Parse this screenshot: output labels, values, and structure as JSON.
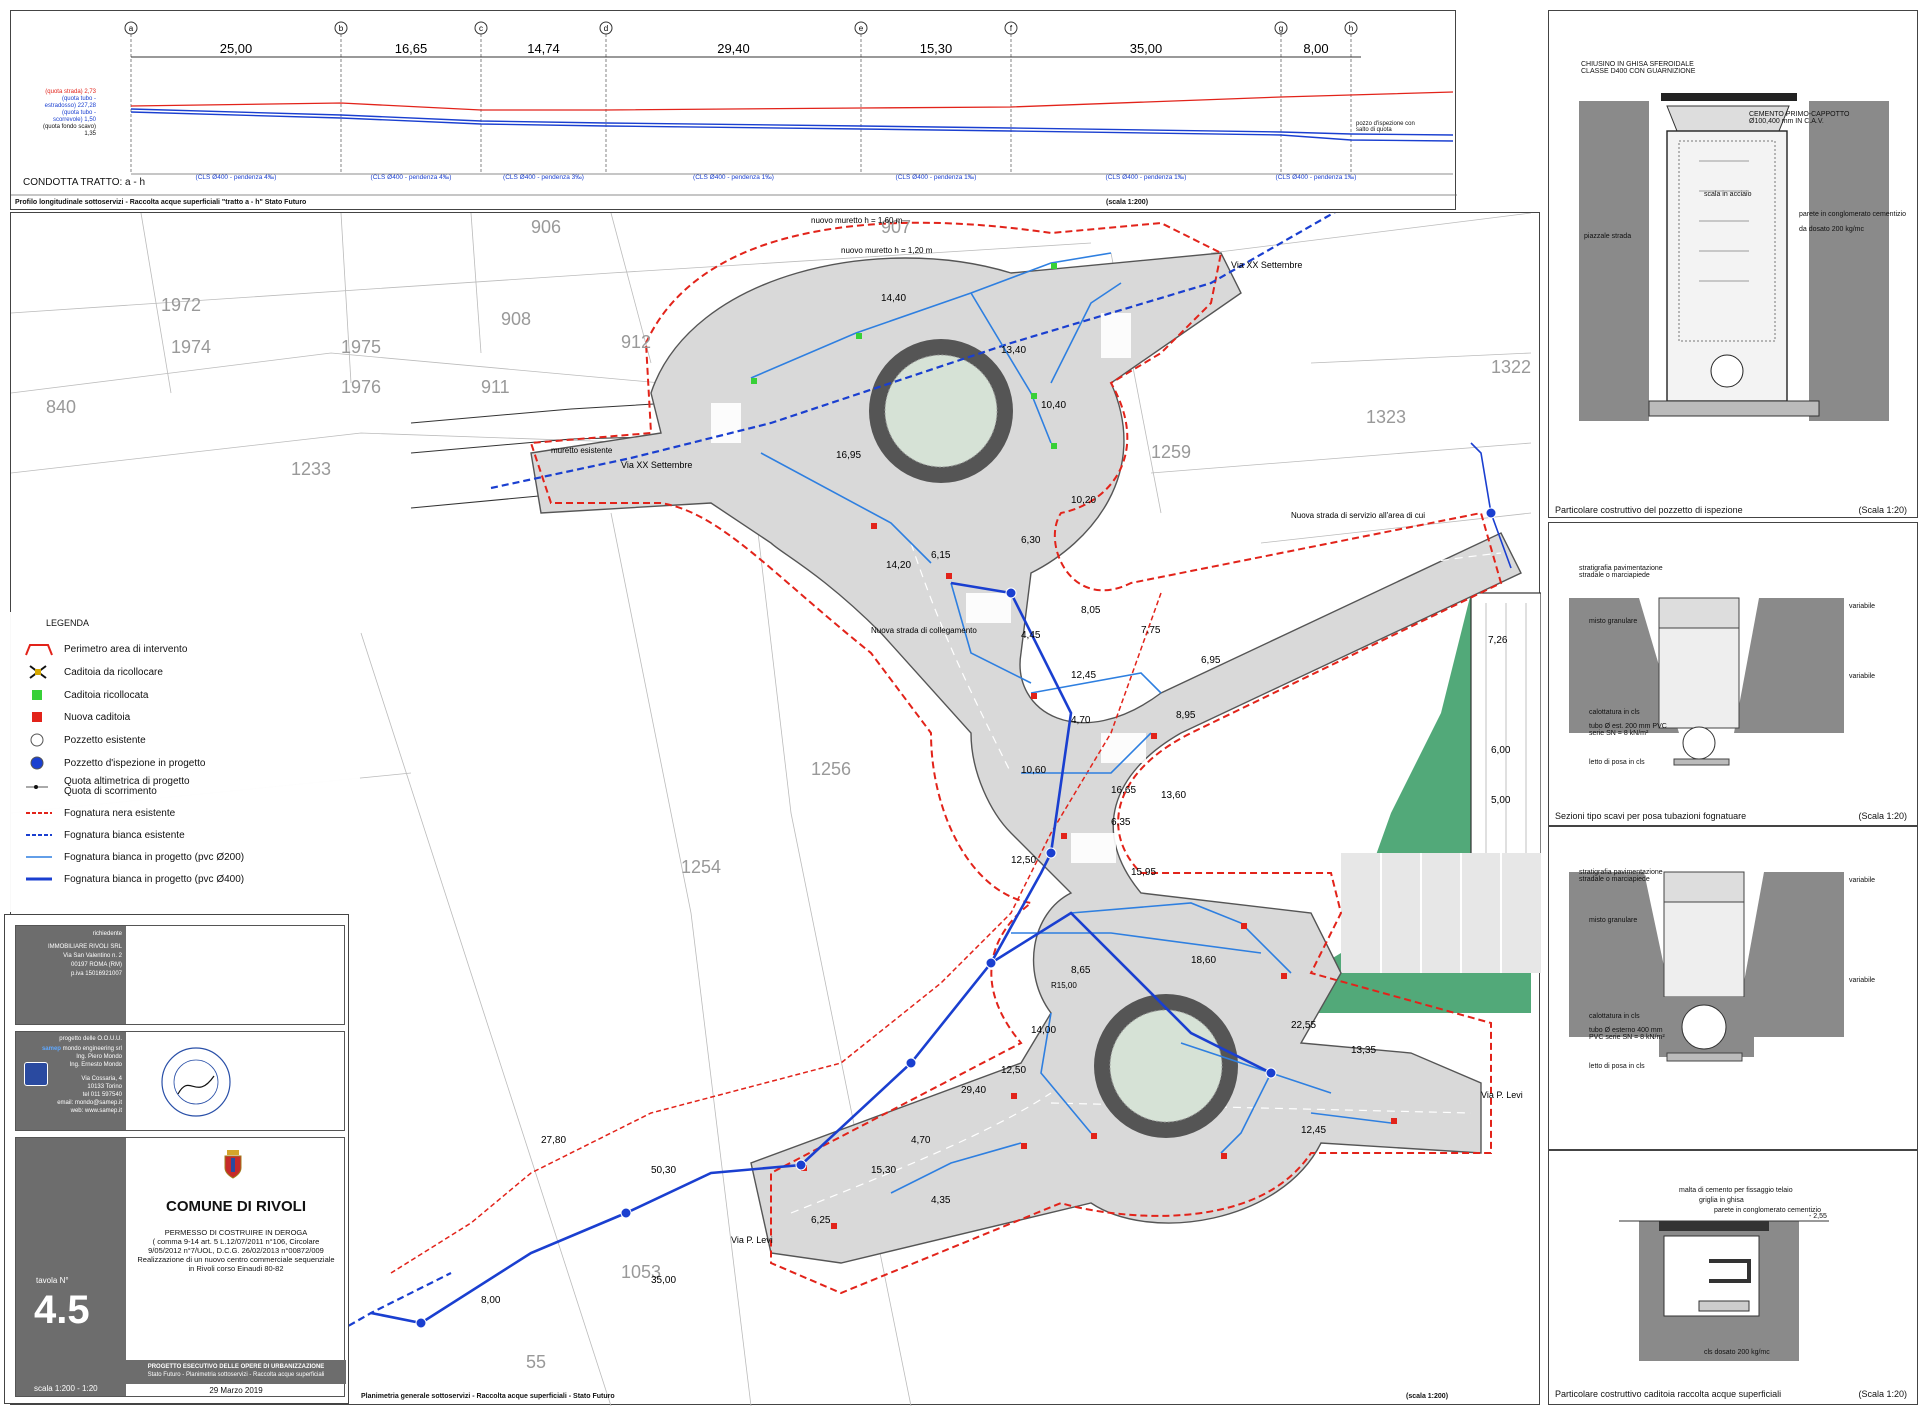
{
  "profile": {
    "markers": [
      "a",
      "b",
      "c",
      "d",
      "e",
      "f",
      "g",
      "h"
    ],
    "distances": [
      "25,00",
      "16,65",
      "14,74",
      "29,40",
      "15,30",
      "35,00",
      "8,00"
    ],
    "quota_labels": [
      "(quota strada) 2,73",
      "(quota tubo - estradosso) 227,28",
      "(quota tubo - scorrevole) 1,50",
      "(quota fondo scavo) 1,35"
    ],
    "conduit_label": "CONDOTTA TRATTO: a - h",
    "segment_notes": [
      "(CLS Ø400 - pendenza 4‰)",
      "(CLS Ø400 - pendenza 4‰)",
      "(CLS Ø400 - pendenza 3‰)",
      "(CLS Ø400 - pendenza 1‰)",
      "(CLS Ø400 - pendenza 1‰)",
      "(CLS Ø400 - pendenza 1‰)",
      "(CLS Ø400 - pendenza 1‰)"
    ],
    "inspection_note": "pozzo d'ispezione con salto di quota",
    "caption": "Profilo longitudinale sottoservizi - Raccolta acque superficiali \"tratto a - h\" Stato Futuro",
    "scale": "(scala 1:200)"
  },
  "plan": {
    "caption": "Planimetria generale sottoservizi - Raccolta acque superficiali - Stato Futuro",
    "scale": "(scala 1:200)",
    "parcels": [
      "906",
      "907",
      "1972",
      "908",
      "1974",
      "1975",
      "912",
      "1976",
      "911",
      "840",
      "1233",
      "1322",
      "1323",
      "1259",
      "1256",
      "1254",
      "1053",
      "55"
    ],
    "street_labels": [
      "Via XX Settembre",
      "Via XX Settembre",
      "Via P. Levi",
      "Via P. Levi"
    ],
    "notes": [
      "Nuova strada di servizio all'area di cui",
      "Nuova strada di collegamento",
      "muretto esistente",
      "nuovo muretto h = 1,60 m",
      "nuovo muretto h = 1,20 m",
      "R15,00"
    ],
    "dimensions": [
      "14,40",
      "13,40",
      "10,40",
      "10,20",
      "16,95",
      "14,20",
      "6,15",
      "6,30",
      "8,05",
      "4,45",
      "12,45",
      "4,70",
      "10,60",
      "16,65",
      "6,35",
      "15,95",
      "18,60",
      "8,65",
      "14,00",
      "29,40",
      "15,30",
      "4,70",
      "4,35",
      "6,25",
      "35,00",
      "8,00",
      "50,30",
      "27,80",
      "12,45",
      "13,35",
      "22,55",
      "7,75",
      "6,95",
      "8,95",
      "13,60",
      "12,50",
      "7,26",
      "6,00",
      "5,00",
      "12,50"
    ]
  },
  "legend": {
    "title": "LEGENDA",
    "items": [
      {
        "label": "Perimetro area di intervento",
        "icon": "perimeter-icon"
      },
      {
        "label": "Caditoia da ricollocare",
        "icon": "cross-icon"
      },
      {
        "label": "Caditoia ricollocata",
        "icon": "green-square-icon"
      },
      {
        "label": "Nuova caditoia",
        "icon": "red-square-icon"
      },
      {
        "label": "Pozzetto esistente",
        "icon": "circle-icon"
      },
      {
        "label": "Pozzetto d'ispezione in progetto",
        "icon": "blue-circle-icon"
      },
      {
        "label": "Quota altimetrica di progetto",
        "label2": "Quota di scorrimento",
        "icon": "quota-icon"
      },
      {
        "label": "Fognatura nera esistente",
        "icon": "red-dashed-icon"
      },
      {
        "label": "Fognatura bianca esistente",
        "icon": "blue-dashed-icon"
      },
      {
        "label": "Fognatura bianca in progetto (pvc Ø200)",
        "icon": "thin-blue-line-icon"
      },
      {
        "label": "Fognatura bianca in progetto (pvc Ø400)",
        "icon": "thick-blue-line-icon"
      }
    ]
  },
  "titleblock": {
    "applicant_title": "richiedente",
    "applicant_lines": [
      "IMMOBILIARE RIVOLI SRL",
      "Via San Valentino n. 2",
      "00197 ROMA (RM)",
      "p.iva 15016921007"
    ],
    "designer_title": "progetto delle O.O.U.U.",
    "designer_lines": [
      "mondo engineering srl",
      "Ing. Piero Mondo",
      "Ing. Ernesto Mondo",
      "Via Cossaria, 4",
      "10133 Torino",
      "tel 011 597540",
      "email: mondo@samep.it",
      "web: www.samep.it"
    ],
    "samep": "samep",
    "municipality": "COMUNE DI RIVOLI",
    "permit_lines": [
      "PERMESSO DI COSTRUIRE IN DEROGA",
      "( comma 9-14 art. 5 L.12/07/2011 n°106, Circolare",
      "9/05/2012 n°7/UOL, D.C.G. 26/02/2013 n°00872/009",
      "Realizzazione di un nuovo centro commerciale sequenziale",
      "in Rivoli corso Einaudi 80-82"
    ],
    "tavola_label": "tavola N°",
    "tavola_number": "4.5",
    "scale": "scala 1:200 - 1:20",
    "project_lines": [
      "PROGETTO ESECUTIVO DELLE OPERE DI URBANIZZAZIONE",
      "Stato Futuro - Planimetria sottoservizi - Raccolta acque superficiali"
    ],
    "date": "29 Marzo 2019"
  },
  "details": [
    {
      "caption": "Particolare costruttivo del pozzetto di ispezione",
      "scale": "(Scala 1:20)",
      "labels": [
        "CHIUSINO IN GHISA SFEROIDALE CLASSE D400 CON GUARNIZIONE",
        "CEMENTO PRIMO-CAPPOTTO Ø100,400 mm IN C.A.V.",
        "scala in acciaio",
        "parete in conglomerato cementizio",
        "da dosato 200 kg/mc",
        "piazzale strada"
      ]
    },
    {
      "caption": "Sezioni tipo scavi per posa tubazioni fognatuare",
      "scale": "(Scala 1:20)",
      "labels": [
        "stratigrafia pavimentazione stradale o marciapiede",
        "misto granulare",
        "calottatura in cls",
        "tubo Ø est. 200 mm PVC serie SN = 8 kN/m²",
        "letto di posa in cls",
        "variabile",
        "variabile"
      ]
    },
    {
      "caption": "",
      "scale": "",
      "labels": [
        "stratigrafia pavimentazione stradale o marciapiede",
        "misto granulare",
        "calottatura in cls",
        "tubo Ø esterno 400 mm PVC serie SN = 8 kN/m²",
        "letto di posa in cls",
        "variabile",
        "variabile"
      ]
    },
    {
      "caption": "Particolare costruttivo caditoia raccolta acque superficiali",
      "scale": "(Scala 1:20)",
      "labels": [
        "malta di cemento per fissaggio telaio",
        "griglia in ghisa",
        "parete in conglomerato cementizio",
        "cls dosato 200 kg/mc",
        "- 2,55"
      ]
    }
  ],
  "colors": {
    "red": "#e2231a",
    "blue": "#1a3fd0",
    "lightblue": "#2e7fe0",
    "green": "#3fa06a",
    "road": "#d9d9d9",
    "dark": "#4a4a4a"
  }
}
